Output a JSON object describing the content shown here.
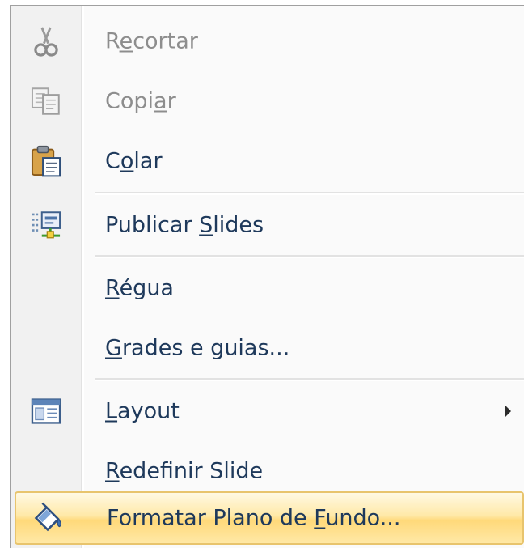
{
  "menu": {
    "items": [
      {
        "label_pre": "R",
        "label_key": "e",
        "label_post": "cortar",
        "icon": "scissors-icon",
        "enabled": false
      },
      {
        "label_pre": "Copi",
        "label_key": "a",
        "label_post": "r",
        "icon": "copy-icon",
        "enabled": false
      },
      {
        "label_pre": "C",
        "label_key": "o",
        "label_post": "lar",
        "icon": "paste-icon",
        "enabled": true
      },
      {
        "label_pre": "Publicar ",
        "label_key": "S",
        "label_post": "lides",
        "icon": "publish-slides-icon",
        "enabled": true
      },
      {
        "label_pre": "",
        "label_key": "R",
        "label_post": "égua",
        "enabled": true
      },
      {
        "label_pre": "",
        "label_key": "G",
        "label_post": "rades e guias...",
        "enabled": true
      },
      {
        "label_pre": "",
        "label_key": "L",
        "label_post": "ayout",
        "icon": "layout-icon",
        "has_submenu": true,
        "enabled": true
      },
      {
        "label_pre": "",
        "label_key": "R",
        "label_post": "edefinir Slide",
        "enabled": true
      },
      {
        "label_pre": "Formatar Plano de ",
        "label_key": "F",
        "label_post": "undo...",
        "icon": "paint-bucket-icon",
        "highlighted": true,
        "enabled": true
      }
    ]
  },
  "colors": {
    "text": "#1e395b",
    "disabled_text": "#8d8d8d",
    "highlight": "#ffe08f",
    "highlight_border": "#e8c46d"
  }
}
